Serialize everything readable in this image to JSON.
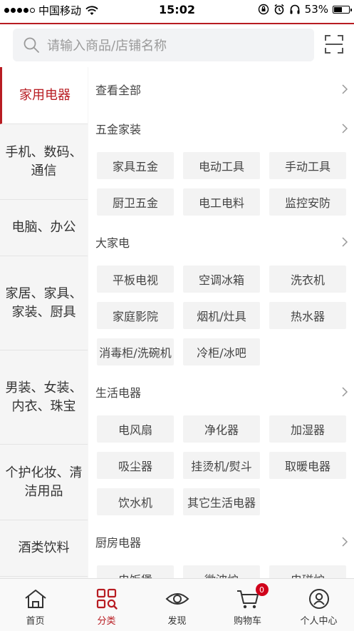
{
  "status_bar": {
    "carrier": "中国移动",
    "time": "15:02",
    "battery": "53%",
    "battery_level": 0.53
  },
  "search": {
    "placeholder": "请输入商品/店铺名称"
  },
  "sidebar": {
    "items": [
      {
        "label": "家用电器",
        "active": true
      },
      {
        "label": "手机、数码、通信"
      },
      {
        "label": "电脑、办公"
      },
      {
        "label": "家居、家具、家装、厨具"
      },
      {
        "label": "男装、女装、内衣、珠宝"
      },
      {
        "label": "个护化妆、清洁用品"
      },
      {
        "label": "酒类饮料"
      },
      {
        "label": ""
      }
    ]
  },
  "content": {
    "view_all": "查看全部",
    "sections": [
      {
        "title": "五金家装",
        "tags": [
          "家具五金",
          "电动工具",
          "手动工具",
          "厨卫五金",
          "电工电料",
          "监控安防"
        ]
      },
      {
        "title": "大家电",
        "tags": [
          "平板电视",
          "空调冰箱",
          "洗衣机",
          "家庭影院",
          "烟机/灶具",
          "热水器",
          "消毒柜/洗碗机",
          "冷柜/冰吧"
        ]
      },
      {
        "title": "生活电器",
        "tags": [
          "电风扇",
          "净化器",
          "加湿器",
          "吸尘器",
          "挂烫机/熨斗",
          "取暖电器",
          "饮水机",
          "其它生活电器"
        ]
      },
      {
        "title": "厨房电器",
        "tags": [
          "电饭煲",
          "微波炉",
          "电磁炉"
        ]
      }
    ]
  },
  "tab_bar": {
    "items": [
      {
        "label": "首页",
        "icon": "home-icon"
      },
      {
        "label": "分类",
        "icon": "category-icon",
        "active": true
      },
      {
        "label": "发现",
        "icon": "eye-icon"
      },
      {
        "label": "购物车",
        "icon": "cart-icon",
        "badge": "0"
      },
      {
        "label": "个人中心",
        "icon": "user-icon"
      }
    ]
  },
  "colors": {
    "accent": "#b81c22",
    "badge": "#d0021b"
  }
}
